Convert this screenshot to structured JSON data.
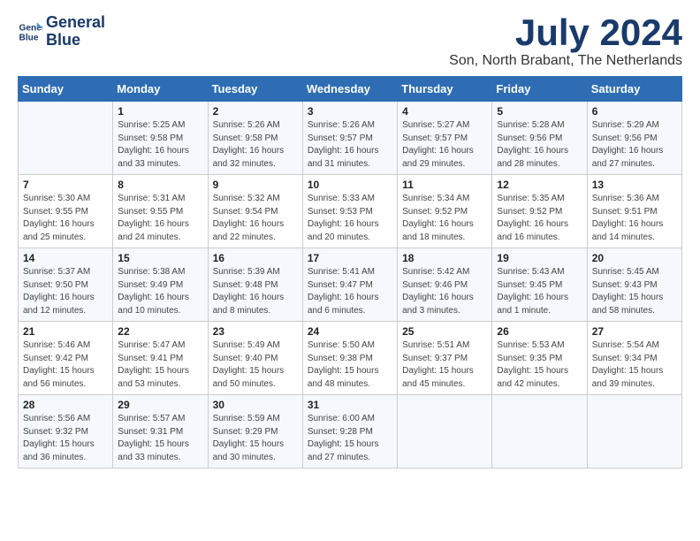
{
  "logo": {
    "line1": "General",
    "line2": "Blue"
  },
  "title": "July 2024",
  "location": "Son, North Brabant, The Netherlands",
  "weekdays": [
    "Sunday",
    "Monday",
    "Tuesday",
    "Wednesday",
    "Thursday",
    "Friday",
    "Saturday"
  ],
  "weeks": [
    [
      {
        "day": "",
        "info": ""
      },
      {
        "day": "1",
        "info": "Sunrise: 5:25 AM\nSunset: 9:58 PM\nDaylight: 16 hours\nand 33 minutes."
      },
      {
        "day": "2",
        "info": "Sunrise: 5:26 AM\nSunset: 9:58 PM\nDaylight: 16 hours\nand 32 minutes."
      },
      {
        "day": "3",
        "info": "Sunrise: 5:26 AM\nSunset: 9:57 PM\nDaylight: 16 hours\nand 31 minutes."
      },
      {
        "day": "4",
        "info": "Sunrise: 5:27 AM\nSunset: 9:57 PM\nDaylight: 16 hours\nand 29 minutes."
      },
      {
        "day": "5",
        "info": "Sunrise: 5:28 AM\nSunset: 9:56 PM\nDaylight: 16 hours\nand 28 minutes."
      },
      {
        "day": "6",
        "info": "Sunrise: 5:29 AM\nSunset: 9:56 PM\nDaylight: 16 hours\nand 27 minutes."
      }
    ],
    [
      {
        "day": "7",
        "info": "Sunrise: 5:30 AM\nSunset: 9:55 PM\nDaylight: 16 hours\nand 25 minutes."
      },
      {
        "day": "8",
        "info": "Sunrise: 5:31 AM\nSunset: 9:55 PM\nDaylight: 16 hours\nand 24 minutes."
      },
      {
        "day": "9",
        "info": "Sunrise: 5:32 AM\nSunset: 9:54 PM\nDaylight: 16 hours\nand 22 minutes."
      },
      {
        "day": "10",
        "info": "Sunrise: 5:33 AM\nSunset: 9:53 PM\nDaylight: 16 hours\nand 20 minutes."
      },
      {
        "day": "11",
        "info": "Sunrise: 5:34 AM\nSunset: 9:52 PM\nDaylight: 16 hours\nand 18 minutes."
      },
      {
        "day": "12",
        "info": "Sunrise: 5:35 AM\nSunset: 9:52 PM\nDaylight: 16 hours\nand 16 minutes."
      },
      {
        "day": "13",
        "info": "Sunrise: 5:36 AM\nSunset: 9:51 PM\nDaylight: 16 hours\nand 14 minutes."
      }
    ],
    [
      {
        "day": "14",
        "info": "Sunrise: 5:37 AM\nSunset: 9:50 PM\nDaylight: 16 hours\nand 12 minutes."
      },
      {
        "day": "15",
        "info": "Sunrise: 5:38 AM\nSunset: 9:49 PM\nDaylight: 16 hours\nand 10 minutes."
      },
      {
        "day": "16",
        "info": "Sunrise: 5:39 AM\nSunset: 9:48 PM\nDaylight: 16 hours\nand 8 minutes."
      },
      {
        "day": "17",
        "info": "Sunrise: 5:41 AM\nSunset: 9:47 PM\nDaylight: 16 hours\nand 6 minutes."
      },
      {
        "day": "18",
        "info": "Sunrise: 5:42 AM\nSunset: 9:46 PM\nDaylight: 16 hours\nand 3 minutes."
      },
      {
        "day": "19",
        "info": "Sunrise: 5:43 AM\nSunset: 9:45 PM\nDaylight: 16 hours\nand 1 minute."
      },
      {
        "day": "20",
        "info": "Sunrise: 5:45 AM\nSunset: 9:43 PM\nDaylight: 15 hours\nand 58 minutes."
      }
    ],
    [
      {
        "day": "21",
        "info": "Sunrise: 5:46 AM\nSunset: 9:42 PM\nDaylight: 15 hours\nand 56 minutes."
      },
      {
        "day": "22",
        "info": "Sunrise: 5:47 AM\nSunset: 9:41 PM\nDaylight: 15 hours\nand 53 minutes."
      },
      {
        "day": "23",
        "info": "Sunrise: 5:49 AM\nSunset: 9:40 PM\nDaylight: 15 hours\nand 50 minutes."
      },
      {
        "day": "24",
        "info": "Sunrise: 5:50 AM\nSunset: 9:38 PM\nDaylight: 15 hours\nand 48 minutes."
      },
      {
        "day": "25",
        "info": "Sunrise: 5:51 AM\nSunset: 9:37 PM\nDaylight: 15 hours\nand 45 minutes."
      },
      {
        "day": "26",
        "info": "Sunrise: 5:53 AM\nSunset: 9:35 PM\nDaylight: 15 hours\nand 42 minutes."
      },
      {
        "day": "27",
        "info": "Sunrise: 5:54 AM\nSunset: 9:34 PM\nDaylight: 15 hours\nand 39 minutes."
      }
    ],
    [
      {
        "day": "28",
        "info": "Sunrise: 5:56 AM\nSunset: 9:32 PM\nDaylight: 15 hours\nand 36 minutes."
      },
      {
        "day": "29",
        "info": "Sunrise: 5:57 AM\nSunset: 9:31 PM\nDaylight: 15 hours\nand 33 minutes."
      },
      {
        "day": "30",
        "info": "Sunrise: 5:59 AM\nSunset: 9:29 PM\nDaylight: 15 hours\nand 30 minutes."
      },
      {
        "day": "31",
        "info": "Sunrise: 6:00 AM\nSunset: 9:28 PM\nDaylight: 15 hours\nand 27 minutes."
      },
      {
        "day": "",
        "info": ""
      },
      {
        "day": "",
        "info": ""
      },
      {
        "day": "",
        "info": ""
      }
    ]
  ]
}
